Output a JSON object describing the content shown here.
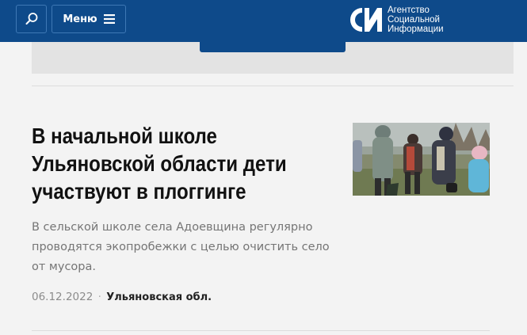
{
  "header": {
    "menu_label": "Меню",
    "logo_lines": [
      "Агентство",
      "Социальной",
      "Информации"
    ]
  },
  "article": {
    "title": "В начальной школе Ульяновской области дети участвуют в плоггинге",
    "lead": "В сельской школе села Адоевщина регулярно проводятся экопробежки с целью очистить село от мусора.",
    "date": "06.12.2022",
    "separator": "·",
    "region": "Ульяновская обл."
  },
  "colors": {
    "header_bg": "#0e4a8a",
    "page_bg": "#f3f3f3"
  },
  "icons": {
    "search": "search-icon",
    "menu": "hamburger-icon",
    "logo": "asi-logo-icon"
  }
}
